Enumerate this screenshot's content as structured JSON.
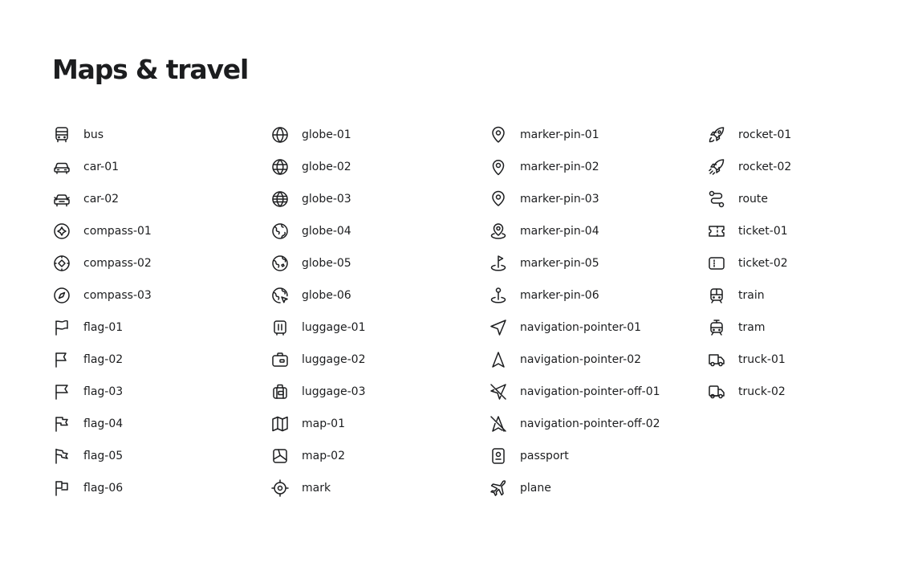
{
  "title": "Maps & travel",
  "stroke_color": "#1c1d1f",
  "columns": [
    {
      "items": [
        {
          "label": "bus",
          "icon": "bus"
        },
        {
          "label": "car-01",
          "icon": "car-01"
        },
        {
          "label": "car-02",
          "icon": "car-02"
        },
        {
          "label": "compass-01",
          "icon": "compass-01"
        },
        {
          "label": "compass-02",
          "icon": "compass-02"
        },
        {
          "label": "compass-03",
          "icon": "compass-03"
        },
        {
          "label": "flag-01",
          "icon": "flag-01"
        },
        {
          "label": "flag-02",
          "icon": "flag-02"
        },
        {
          "label": "flag-03",
          "icon": "flag-03"
        },
        {
          "label": "flag-04",
          "icon": "flag-04"
        },
        {
          "label": "flag-05",
          "icon": "flag-05"
        },
        {
          "label": "flag-06",
          "icon": "flag-06"
        }
      ]
    },
    {
      "items": [
        {
          "label": "globe-01",
          "icon": "globe-01"
        },
        {
          "label": "globe-02",
          "icon": "globe-02"
        },
        {
          "label": "globe-03",
          "icon": "globe-03"
        },
        {
          "label": "globe-04",
          "icon": "globe-04"
        },
        {
          "label": "globe-05",
          "icon": "globe-05"
        },
        {
          "label": "globe-06",
          "icon": "globe-06"
        },
        {
          "label": "luggage-01",
          "icon": "luggage-01"
        },
        {
          "label": "luggage-02",
          "icon": "luggage-02"
        },
        {
          "label": "luggage-03",
          "icon": "luggage-03"
        },
        {
          "label": "map-01",
          "icon": "map-01"
        },
        {
          "label": "map-02",
          "icon": "map-02"
        },
        {
          "label": "mark",
          "icon": "mark"
        }
      ]
    },
    {
      "items": [
        {
          "label": "marker-pin-01",
          "icon": "marker-pin-01"
        },
        {
          "label": "marker-pin-02",
          "icon": "marker-pin-02"
        },
        {
          "label": "marker-pin-03",
          "icon": "marker-pin-03"
        },
        {
          "label": "marker-pin-04",
          "icon": "marker-pin-04"
        },
        {
          "label": "marker-pin-05",
          "icon": "marker-pin-05"
        },
        {
          "label": "marker-pin-06",
          "icon": "marker-pin-06"
        },
        {
          "label": "navigation-pointer-01",
          "icon": "navigation-pointer-01"
        },
        {
          "label": "navigation-pointer-02",
          "icon": "navigation-pointer-02"
        },
        {
          "label": "navigation-pointer-off-01",
          "icon": "navigation-pointer-off-01"
        },
        {
          "label": "navigation-pointer-off-02",
          "icon": "navigation-pointer-off-02"
        },
        {
          "label": "passport",
          "icon": "passport"
        },
        {
          "label": "plane",
          "icon": "plane"
        }
      ]
    },
    {
      "items": [
        {
          "label": "rocket-01",
          "icon": "rocket-01"
        },
        {
          "label": "rocket-02",
          "icon": "rocket-02"
        },
        {
          "label": "route",
          "icon": "route"
        },
        {
          "label": "ticket-01",
          "icon": "ticket-01"
        },
        {
          "label": "ticket-02",
          "icon": "ticket-02"
        },
        {
          "label": "train",
          "icon": "train"
        },
        {
          "label": "tram",
          "icon": "tram"
        },
        {
          "label": "truck-01",
          "icon": "truck-01"
        },
        {
          "label": "truck-02",
          "icon": "truck-02"
        }
      ]
    }
  ]
}
